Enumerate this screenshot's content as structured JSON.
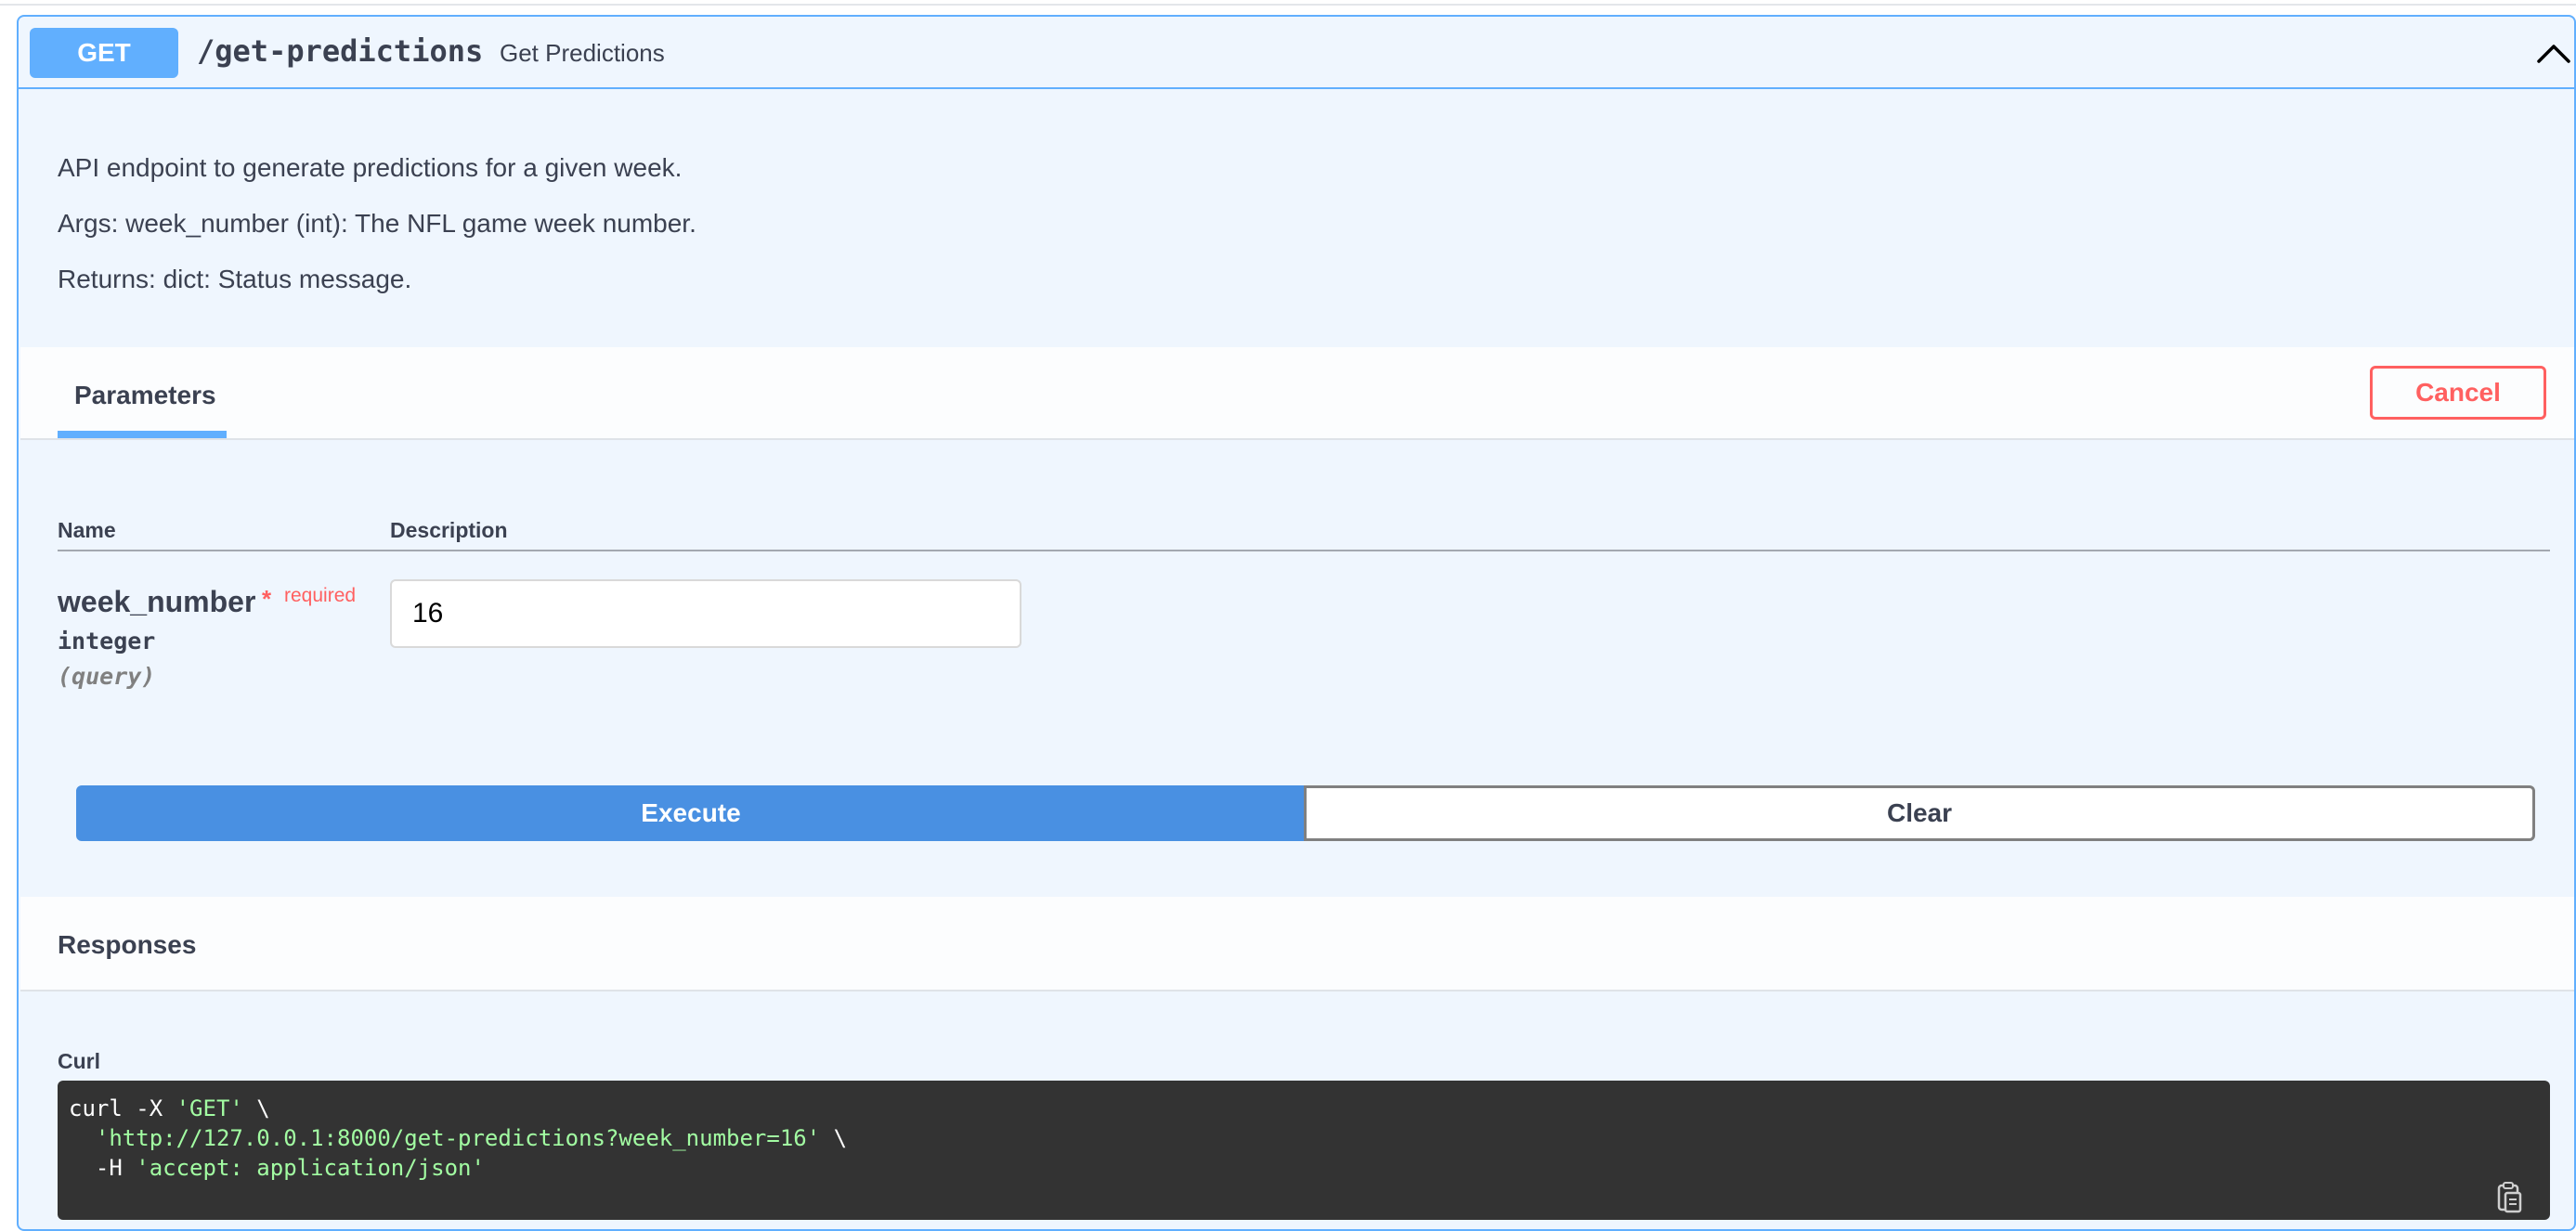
{
  "endpoint": {
    "method": "GET",
    "path": "/get-predictions",
    "summary": "Get Predictions",
    "expanded": true
  },
  "description": [
    "API endpoint to generate predictions for a given week.",
    "Args: week_number (int): The NFL game week number.",
    "Returns: dict: Status message."
  ],
  "parameters_section": {
    "tab_label": "Parameters",
    "cancel_label": "Cancel",
    "columns": {
      "name": "Name",
      "description": "Description"
    },
    "params": [
      {
        "name": "week_number",
        "required_star": "*",
        "required_label": "required",
        "type": "integer",
        "in": "(query)",
        "value": "16"
      }
    ]
  },
  "actions": {
    "execute_label": "Execute",
    "clear_label": "Clear"
  },
  "responses": {
    "title": "Responses",
    "curl_label": "Curl",
    "curl": {
      "line1_prefix": "curl -X ",
      "line1_method": "'GET'",
      "line1_suffix": " \\",
      "line2_indent": "  ",
      "line2_url": "'http://127.0.0.1:8000/get-predictions?week_number=16'",
      "line2_suffix": " \\",
      "line3_prefix": "  -H ",
      "line3_header": "'accept: application/json'"
    }
  },
  "colors": {
    "get_method": "#61affe",
    "execute": "#4990e2",
    "cancel": "#ff6060",
    "required": "#ff6060",
    "curl_bg": "#333333",
    "curl_string": "#a2fca2"
  },
  "icons": {
    "collapse": "chevron-up-icon",
    "copy": "copy-to-clipboard-icon"
  }
}
